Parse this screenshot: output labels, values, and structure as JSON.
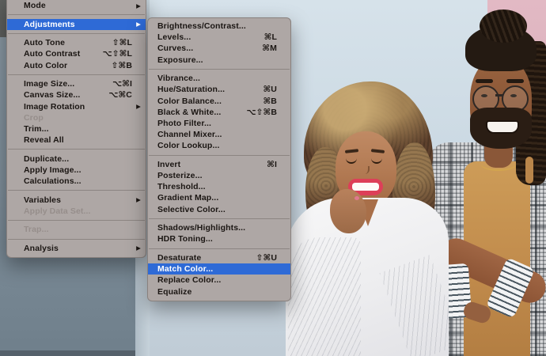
{
  "colors": {
    "menu_background": "#aea7a5",
    "menu_highlight_blue": "#2e6ad6",
    "menu_text": "#1b1613",
    "menu_disabled_text": "#968e8b",
    "wall_blue": "#cbd9e3",
    "wall_pink": "#dcb3be",
    "wall_shadow_gray": "#7e8e9a"
  },
  "image_menu": {
    "items": [
      {
        "label": "Mode",
        "submenu": true
      },
      {
        "separator": true
      },
      {
        "label": "Adjustments",
        "submenu": true,
        "selected": true
      },
      {
        "separator": true
      },
      {
        "label": "Auto Tone",
        "shortcut": "⇧⌘L"
      },
      {
        "label": "Auto Contrast",
        "shortcut": "⌥⇧⌘L"
      },
      {
        "label": "Auto Color",
        "shortcut": "⇧⌘B"
      },
      {
        "separator": true
      },
      {
        "label": "Image Size...",
        "shortcut": "⌥⌘I"
      },
      {
        "label": "Canvas Size...",
        "shortcut": "⌥⌘C"
      },
      {
        "label": "Image Rotation",
        "submenu": true
      },
      {
        "label": "Crop",
        "disabled": true
      },
      {
        "label": "Trim..."
      },
      {
        "label": "Reveal All"
      },
      {
        "separator": true
      },
      {
        "label": "Duplicate..."
      },
      {
        "label": "Apply Image..."
      },
      {
        "label": "Calculations..."
      },
      {
        "separator": true
      },
      {
        "label": "Variables",
        "submenu": true
      },
      {
        "label": "Apply Data Set...",
        "disabled": true
      },
      {
        "separator": true
      },
      {
        "label": "Trap...",
        "disabled": true
      },
      {
        "separator": true
      },
      {
        "label": "Analysis",
        "submenu": true
      }
    ]
  },
  "adjustments_submenu": {
    "items": [
      {
        "label": "Brightness/Contrast..."
      },
      {
        "label": "Levels...",
        "shortcut": "⌘L"
      },
      {
        "label": "Curves...",
        "shortcut": "⌘M"
      },
      {
        "label": "Exposure..."
      },
      {
        "separator": true
      },
      {
        "label": "Vibrance..."
      },
      {
        "label": "Hue/Saturation...",
        "shortcut": "⌘U"
      },
      {
        "label": "Color Balance...",
        "shortcut": "⌘B"
      },
      {
        "label": "Black & White...",
        "shortcut": "⌥⇧⌘B"
      },
      {
        "label": "Photo Filter..."
      },
      {
        "label": "Channel Mixer..."
      },
      {
        "label": "Color Lookup..."
      },
      {
        "separator": true
      },
      {
        "label": "Invert",
        "shortcut": "⌘I"
      },
      {
        "label": "Posterize..."
      },
      {
        "label": "Threshold..."
      },
      {
        "label": "Gradient Map..."
      },
      {
        "label": "Selective Color..."
      },
      {
        "separator": true
      },
      {
        "label": "Shadows/Highlights..."
      },
      {
        "label": "HDR Toning..."
      },
      {
        "separator": true
      },
      {
        "label": "Desaturate",
        "shortcut": "⇧⌘U"
      },
      {
        "label": "Match Color...",
        "selected": true
      },
      {
        "label": "Replace Color..."
      },
      {
        "label": "Equalize"
      }
    ]
  }
}
